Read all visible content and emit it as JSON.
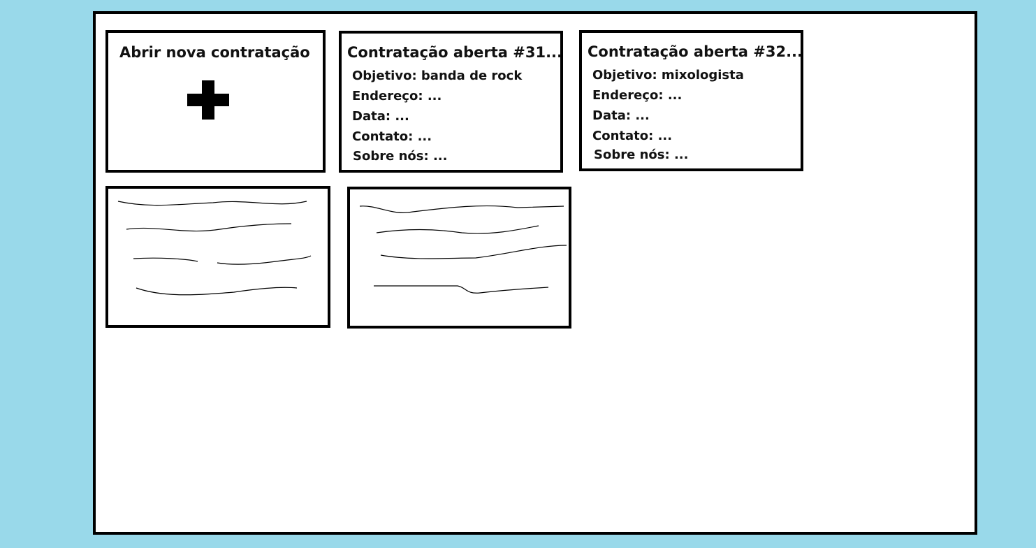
{
  "new_card": {
    "title": "Abrir nova contratação",
    "icon": "plus-icon"
  },
  "open_cards": [
    {
      "title": "Contratação aberta #31...",
      "fields": [
        {
          "label": "Objetivo:",
          "value": "banda de rock"
        },
        {
          "label": "Endereço:",
          "value": "..."
        },
        {
          "label": "Data:",
          "value": "..."
        },
        {
          "label": "Contato:",
          "value": "..."
        },
        {
          "label": "Sobre nós:",
          "value": "..."
        }
      ]
    },
    {
      "title": "Contratação aberta #32...",
      "fields": [
        {
          "label": "Objetivo:",
          "value": "mixologista"
        },
        {
          "label": "Endereço:",
          "value": "..."
        },
        {
          "label": "Data:",
          "value": "..."
        },
        {
          "label": "Contato:",
          "value": "..."
        },
        {
          "label": "Sobre nós:",
          "value": "..."
        }
      ]
    }
  ],
  "colors": {
    "background": "#99d9ea",
    "frame": "#ffffff",
    "border": "#000000"
  }
}
